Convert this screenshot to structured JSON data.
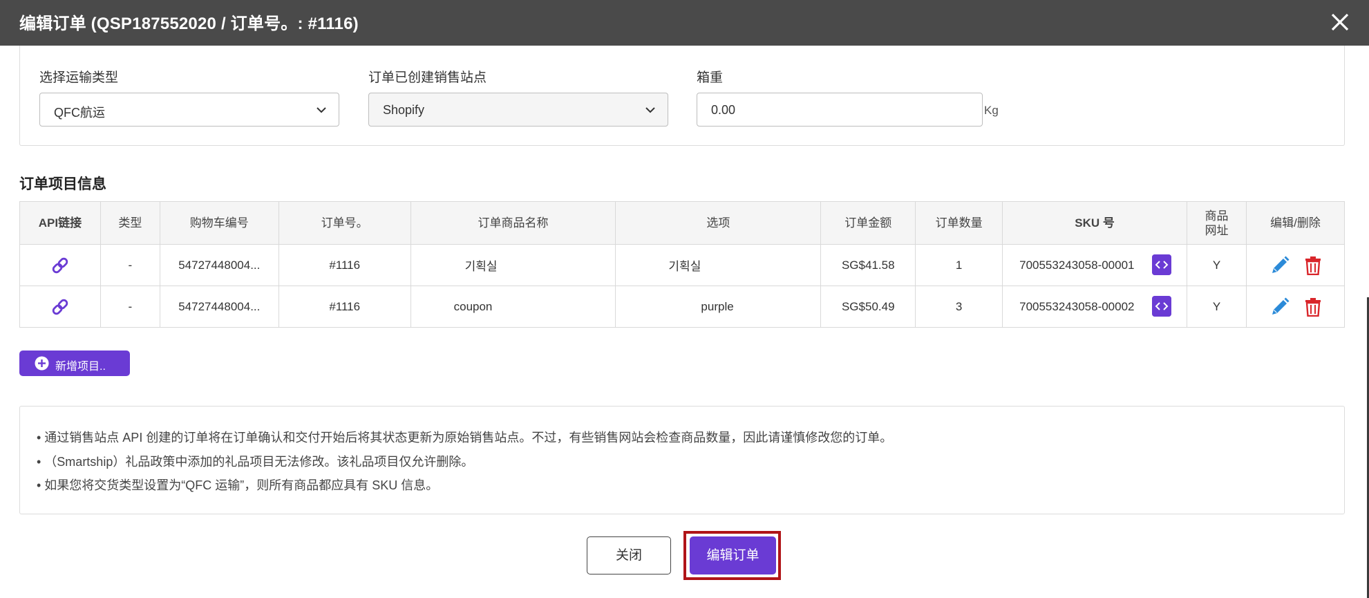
{
  "header": {
    "title": "编辑订单 (QSP187552020 / 订单号。: #1116)"
  },
  "form": {
    "shipping_type": {
      "label": "选择运输类型",
      "value": "QFC航运"
    },
    "sales_site": {
      "label": "订单已创建销售站点",
      "value": "Shopify"
    },
    "box_weight": {
      "label": "箱重",
      "value": "0.00",
      "unit": "Kg"
    }
  },
  "items_section": {
    "title": "订单项目信息",
    "columns": [
      "API链接",
      "类型",
      "购物车编号",
      "订单号。",
      "订单商品名称",
      "选项",
      "订单金额",
      "订单数量",
      "SKU 号",
      "商品网址",
      "编辑/删除"
    ],
    "rows": [
      {
        "type": "-",
        "cart_no": "54727448004...",
        "order_no": "#1116",
        "product_name": "기획실",
        "option": "기획실",
        "amount": "SG$41.58",
        "qty": "1",
        "sku": "700553243058-00001",
        "url": "Y"
      },
      {
        "type": "-",
        "cart_no": "54727448004...",
        "order_no": "#1116",
        "product_name": "coupon",
        "option": "purple",
        "amount": "SG$50.49",
        "qty": "3",
        "sku": "700553243058-00002",
        "url": "Y"
      }
    ],
    "add_button": "新增项目.."
  },
  "notice": {
    "lines": [
      "• 通过销售站点 API 创建的订单将在订单确认和交付开始后将其状态更新为原始销售站点。不过，有些销售网站会检查商品数量，因此请谨慎修改您的订单。",
      "• （Smartship）礼品政策中添加的礼品项目无法修改。该礼品项目仅允许删除。",
      "• 如果您将交货类型设置为“QFC 运输”，则所有商品都应具有 SKU 信息。"
    ]
  },
  "footer": {
    "close_label": "关闭",
    "edit_label": "编辑订单"
  },
  "colors": {
    "header_bg": "#4a4a4a",
    "accent": "#6a3bd4",
    "delete_red": "#d9262b",
    "edit_blue": "#2b8ad8",
    "highlight": "#b01418"
  },
  "icons": [
    "close-icon",
    "chevron-down-icon",
    "link-icon",
    "code-icon",
    "pencil-icon",
    "trash-icon",
    "plus-circle-icon"
  ]
}
